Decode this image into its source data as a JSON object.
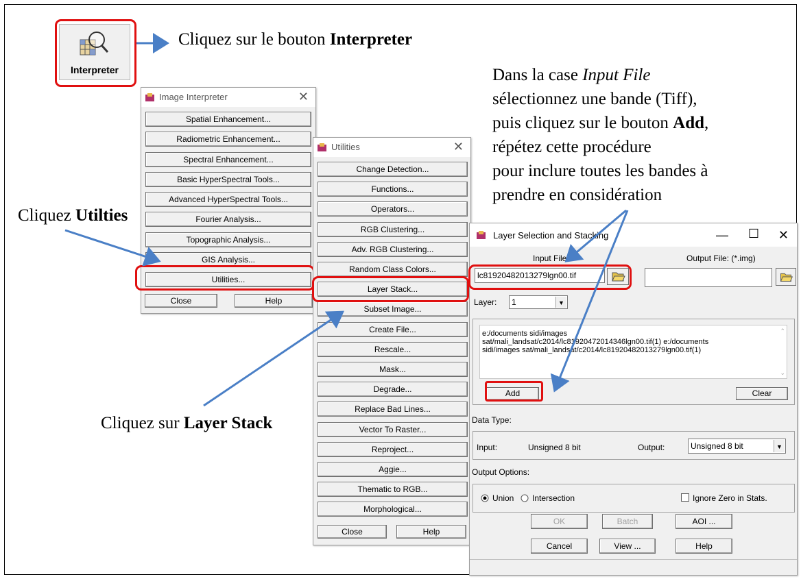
{
  "instructions": {
    "step1_prefix": "Cliquez sur le bouton ",
    "step1_bold": "Interpreter",
    "step2_prefix": "Cliquez ",
    "step2_bold": "Utilties",
    "step3_prefix": "Cliquez sur ",
    "step3_bold": "Layer Stack",
    "step4_line1_prefix": "Dans la case ",
    "step4_line1_italic": "Input File",
    "step4_line2": "sélectionnez une bande (Tiff),",
    "step4_line3_prefix": "puis cliquez sur le bouton ",
    "step4_line3_bold": "Add",
    "step4_line3_suffix": ",",
    "step4_line4": "répétez cette procédure",
    "step4_line5": "pour inclure toutes les bandes à",
    "step4_line6": "prendre en considération"
  },
  "interpreter_icon": {
    "label": "Interpreter",
    "icon": "interpreter-magnifier-icon"
  },
  "image_interpreter": {
    "title": "Image Interpreter",
    "buttons": [
      "Spatial Enhancement...",
      "Radiometric Enhancement...",
      "Spectral Enhancement...",
      "Basic HyperSpectral Tools...",
      "Advanced HyperSpectral Tools...",
      "Fourier Analysis...",
      "Topographic Analysis...",
      "GIS Analysis...",
      "Utilities..."
    ],
    "close": "Close",
    "help": "Help"
  },
  "utilities": {
    "title": "Utilities",
    "buttons": [
      "Change Detection...",
      "Functions...",
      "Operators...",
      "RGB Clustering...",
      "Adv. RGB Clustering...",
      "Random Class Colors...",
      "Layer Stack...",
      "Subset Image...",
      "Create File...",
      "Rescale...",
      "Mask...",
      "Degrade...",
      "Replace Bad Lines...",
      "Vector To Raster...",
      "Reproject...",
      "Aggie...",
      "Thematic to RGB...",
      "Morphological..."
    ],
    "close": "Close",
    "help": "Help"
  },
  "layer_stacking": {
    "title": "Layer Selection and Stacking",
    "minimize": "—",
    "maximize": "☐",
    "close": "✕",
    "input_file_label": "Input File:",
    "output_file_label": "Output File: (*.img)",
    "input_file_value": "lc81920482013279lgn00.tif",
    "output_file_value": "",
    "layer_label": "Layer:",
    "layer_value": "1",
    "file_list": [
      "e:/documents sidi/images",
      "sat/mali_landsat/c2014/lc81920472014346lgn00.tif(1)   e:/documents",
      "sidi/images sat/mali_landsat/c2014/lc81920482013279lgn00.tif(1)"
    ],
    "add": "Add",
    "clear": "Clear",
    "data_type_label": "Data Type:",
    "input_label": "Input:",
    "input_type": "Unsigned 8 bit",
    "output_label": "Output:",
    "output_type": "Unsigned 8 bit",
    "output_options_label": "Output Options:",
    "union": "Union",
    "intersection": "Intersection",
    "ignore_zero": "Ignore Zero in Stats.",
    "ok": "OK",
    "batch": "Batch",
    "aoi": "AOI ...",
    "cancel": "Cancel",
    "view": "View ...",
    "help": "Help"
  }
}
